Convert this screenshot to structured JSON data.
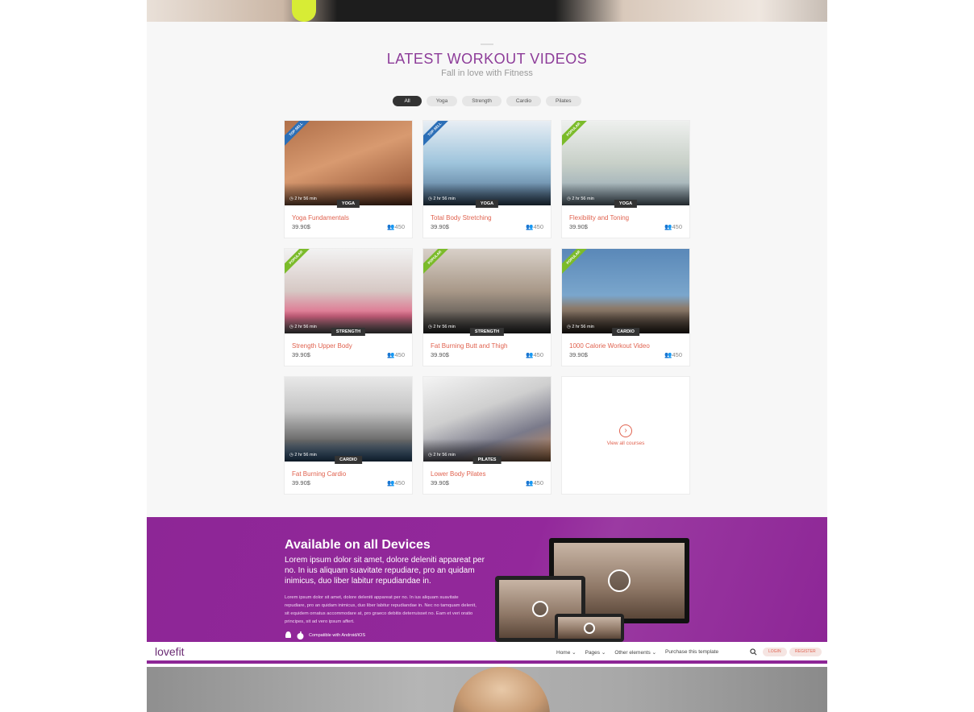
{
  "section": {
    "title": "LATEST WORKOUT VIDEOS",
    "subtitle": "Fall in love with Fitness"
  },
  "filters": [
    "All",
    "Yoga",
    "Strength",
    "Cardio",
    "Pilates"
  ],
  "courses": [
    {
      "title": "Yoga Fundamentals",
      "price": "39.90$",
      "students": "450",
      "category": "YOGA",
      "duration": "2 hr 56 min",
      "ribbon": "TOP SELL"
    },
    {
      "title": "Total Body Stretching",
      "price": "39.90$",
      "students": "450",
      "category": "YOGA",
      "duration": "2 hr 56 min",
      "ribbon": "TOP SELL"
    },
    {
      "title": "Flexibility and Toning",
      "price": "39.90$",
      "students": "450",
      "category": "YOGA",
      "duration": "2 hr 56 min",
      "ribbon": "POPULAR"
    },
    {
      "title": "Strength Upper Body",
      "price": "39.90$",
      "students": "450",
      "category": "STRENGTH",
      "duration": "2 hr 56 min",
      "ribbon": "POPULAR"
    },
    {
      "title": "Fat Burning Butt and Thigh",
      "price": "39.90$",
      "students": "450",
      "category": "STRENGTH",
      "duration": "2 hr 56 min",
      "ribbon": "POPULAR"
    },
    {
      "title": "1000 Calorie Workout Video",
      "price": "39.90$",
      "students": "450",
      "category": "CARDIO",
      "duration": "2 hr 56 min",
      "ribbon": "POPULAR"
    },
    {
      "title": "Fat Burning Cardio",
      "price": "39.90$",
      "students": "450",
      "category": "CARDIO",
      "duration": "2 hr 56 min",
      "ribbon": ""
    },
    {
      "title": "Lower Body Pilates",
      "price": "39.90$",
      "students": "450",
      "category": "PILATES",
      "duration": "2 hr 56 min",
      "ribbon": ""
    }
  ],
  "view_all": "View all courses",
  "devices": {
    "title": "Available on all Devices",
    "lead": "Lorem ipsum dolor sit amet, dolore deleniti appareat per no. In ius aliquam suavitate repudiare, pro an quidam inimicus, duo liber labitur repudiandae in.",
    "body": "Lorem ipsum dolor sit amet, dolore deleniti appareat per no. In ius aliquam suavitate repudiare, pro an quidam inimicus, duo liber labitur repudiandae in. Nec no tamquam delenit, sit equidem ornatus accommodare at, pro graeco debitis deterruisset no. Eam et veri oratio principes, sit ad vero ipsum affert.",
    "compat": "Compatible with Android/iOS"
  },
  "nav": {
    "logo": "lovefit",
    "home": "Home",
    "pages": "Pages",
    "other": "Other elements",
    "purchase": "Purchase this template",
    "login": "LOGIN",
    "register": "REGISTER"
  },
  "colors": {
    "accent": "#8d3c99",
    "link": "#e0624f",
    "band": "#8d2696"
  }
}
